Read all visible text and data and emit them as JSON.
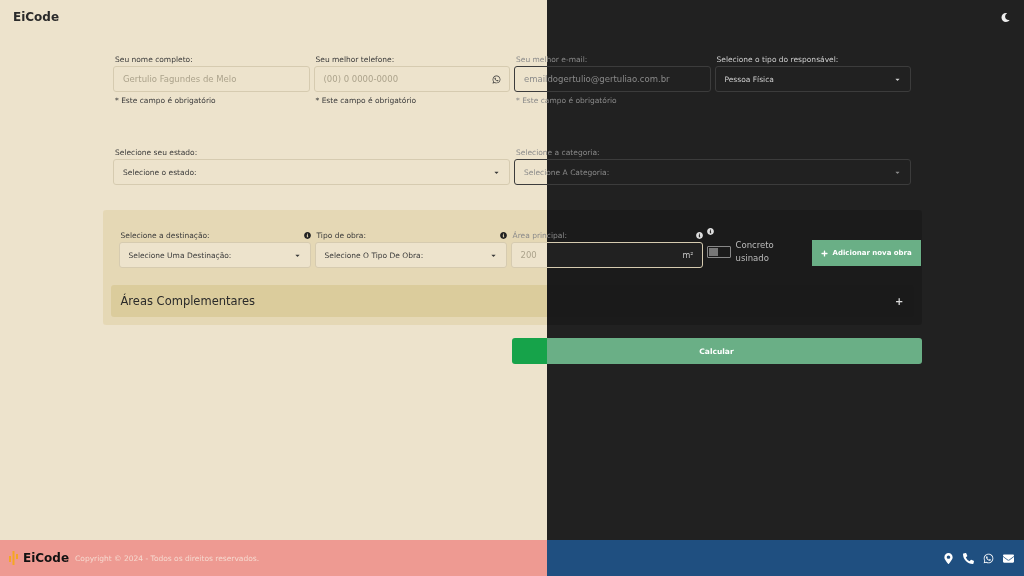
{
  "header": {
    "brand": "EiCode"
  },
  "contact_fields": [
    {
      "kind": "text",
      "label": "Seu nome completo:",
      "placeholder": "Gertulio Fagundes de Melo",
      "helper": "* Este campo é obrigatório"
    },
    {
      "kind": "phone",
      "label": "Seu melhor telefone:",
      "placeholder": "(00) 0 0000-0000",
      "helper": "* Este campo é obrigatório"
    },
    {
      "kind": "text",
      "label": "Seu melhor e-mail:",
      "placeholder": "emaildogertulio@gertuliao.com.br",
      "helper": "* Este campo é obrigatório"
    },
    {
      "kind": "select",
      "label": "Selecione o tipo do responsável:",
      "value": "Pessoa Física"
    }
  ],
  "location_fields": [
    {
      "kind": "select",
      "label": "Selecione seu estado:",
      "value": "Selecione o estado:"
    },
    {
      "kind": "select",
      "label": "Selecione a categoria:",
      "value": "Selecione A Categoria:"
    }
  ],
  "obra": {
    "fields": [
      {
        "kind": "select",
        "label": "Selecione a destinação:",
        "value": "Selecione Uma Destinação:"
      },
      {
        "kind": "select",
        "label": "Tipo de obra:",
        "value": "Selecione O Tipo De Obra:"
      },
      {
        "kind": "area",
        "label": "Área principal:",
        "placeholder": "200",
        "unit": "m²"
      }
    ],
    "switch": {
      "label": "Concreto usinado",
      "on": false
    },
    "add_button": "Adicionar nova obra",
    "accordion": {
      "title": "Áreas Complementares",
      "toggle": "+",
      "expanded": false
    }
  },
  "calculate_button": "Calcular",
  "footer": {
    "logo": "EiCode",
    "copyright": "Copyright © 2024 - Todos os direitos reservados."
  }
}
